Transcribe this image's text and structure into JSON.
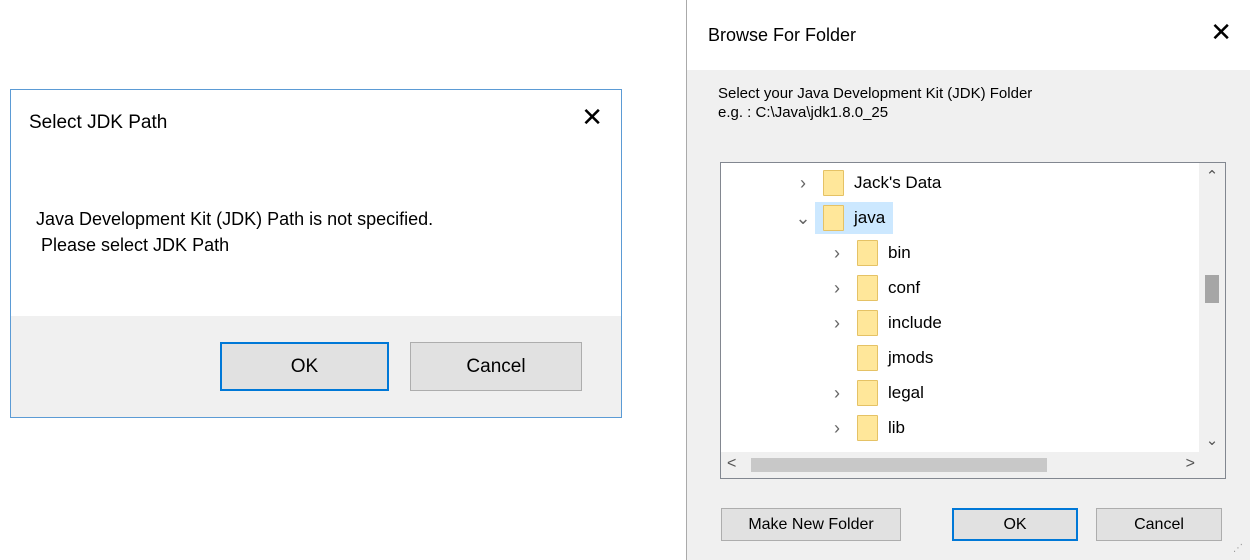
{
  "dialog1": {
    "title": "Select JDK Path",
    "close_glyph": "✕",
    "message": "Java Development Kit (JDK) Path is not specified.\n Please select JDK Path",
    "ok_label": "OK",
    "cancel_label": "Cancel"
  },
  "dialog2": {
    "title": "Browse For Folder",
    "close_glyph": "✕",
    "instruction_line1": "Select your Java Development Kit (JDK) Folder",
    "instruction_line2": "e.g. : C:\\Java\\jdk1.8.0_25",
    "tree": {
      "items": [
        {
          "label": "Jack's Data",
          "chevron": "›",
          "depth": 0,
          "selected": false
        },
        {
          "label": "java",
          "chevron": "⌄",
          "depth": 0,
          "selected": true
        },
        {
          "label": "bin",
          "chevron": "›",
          "depth": 1,
          "selected": false
        },
        {
          "label": "conf",
          "chevron": "›",
          "depth": 1,
          "selected": false
        },
        {
          "label": "include",
          "chevron": "›",
          "depth": 1,
          "selected": false
        },
        {
          "label": "jmods",
          "chevron": "",
          "depth": 1,
          "selected": false
        },
        {
          "label": "legal",
          "chevron": "›",
          "depth": 1,
          "selected": false
        },
        {
          "label": "lib",
          "chevron": "›",
          "depth": 1,
          "selected": false
        }
      ]
    },
    "scroll_up_glyph": "⌃",
    "scroll_down_glyph": "⌄",
    "scroll_left_glyph": "<",
    "scroll_right_glyph": ">",
    "make_new_folder_label": "Make New Folder",
    "ok_label": "OK",
    "cancel_label": "Cancel"
  },
  "colors": {
    "accent": "#0078d7",
    "selection": "#cce8ff",
    "folder": "#ffe79a"
  }
}
